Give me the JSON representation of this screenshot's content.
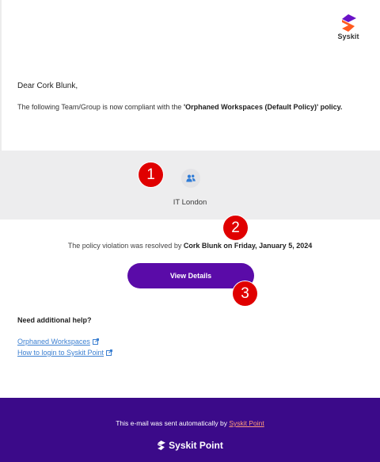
{
  "logo": {
    "text": "Syskit"
  },
  "email": {
    "greeting": "Dear Cork Blunk,",
    "message_prefix": "The following Team/Group is now compliant with the ",
    "policy_name": "'Orphaned Workspaces (Default Policy)' policy.",
    "team_name": "IT London",
    "resolved_prefix": "The policy violation was resolved by ",
    "resolved_by": "Cork Blunk on Friday, January 5, 2024",
    "button_label": "View Details",
    "help_title": "Need additional help?",
    "links": [
      {
        "label": "Orphaned Workspaces"
      },
      {
        "label": "How to login to Syskit Point"
      }
    ]
  },
  "markers": [
    "1",
    "2",
    "3"
  ],
  "footer": {
    "note_prefix": "This e-mail was sent automatically by ",
    "note_link": "Syskit Point",
    "brand": "Syskit Point"
  },
  "colors": {
    "accent": "#5a0ba8",
    "footer_bg": "#3b0a89",
    "link": "#3b7fd1",
    "marker": "#e00000"
  }
}
